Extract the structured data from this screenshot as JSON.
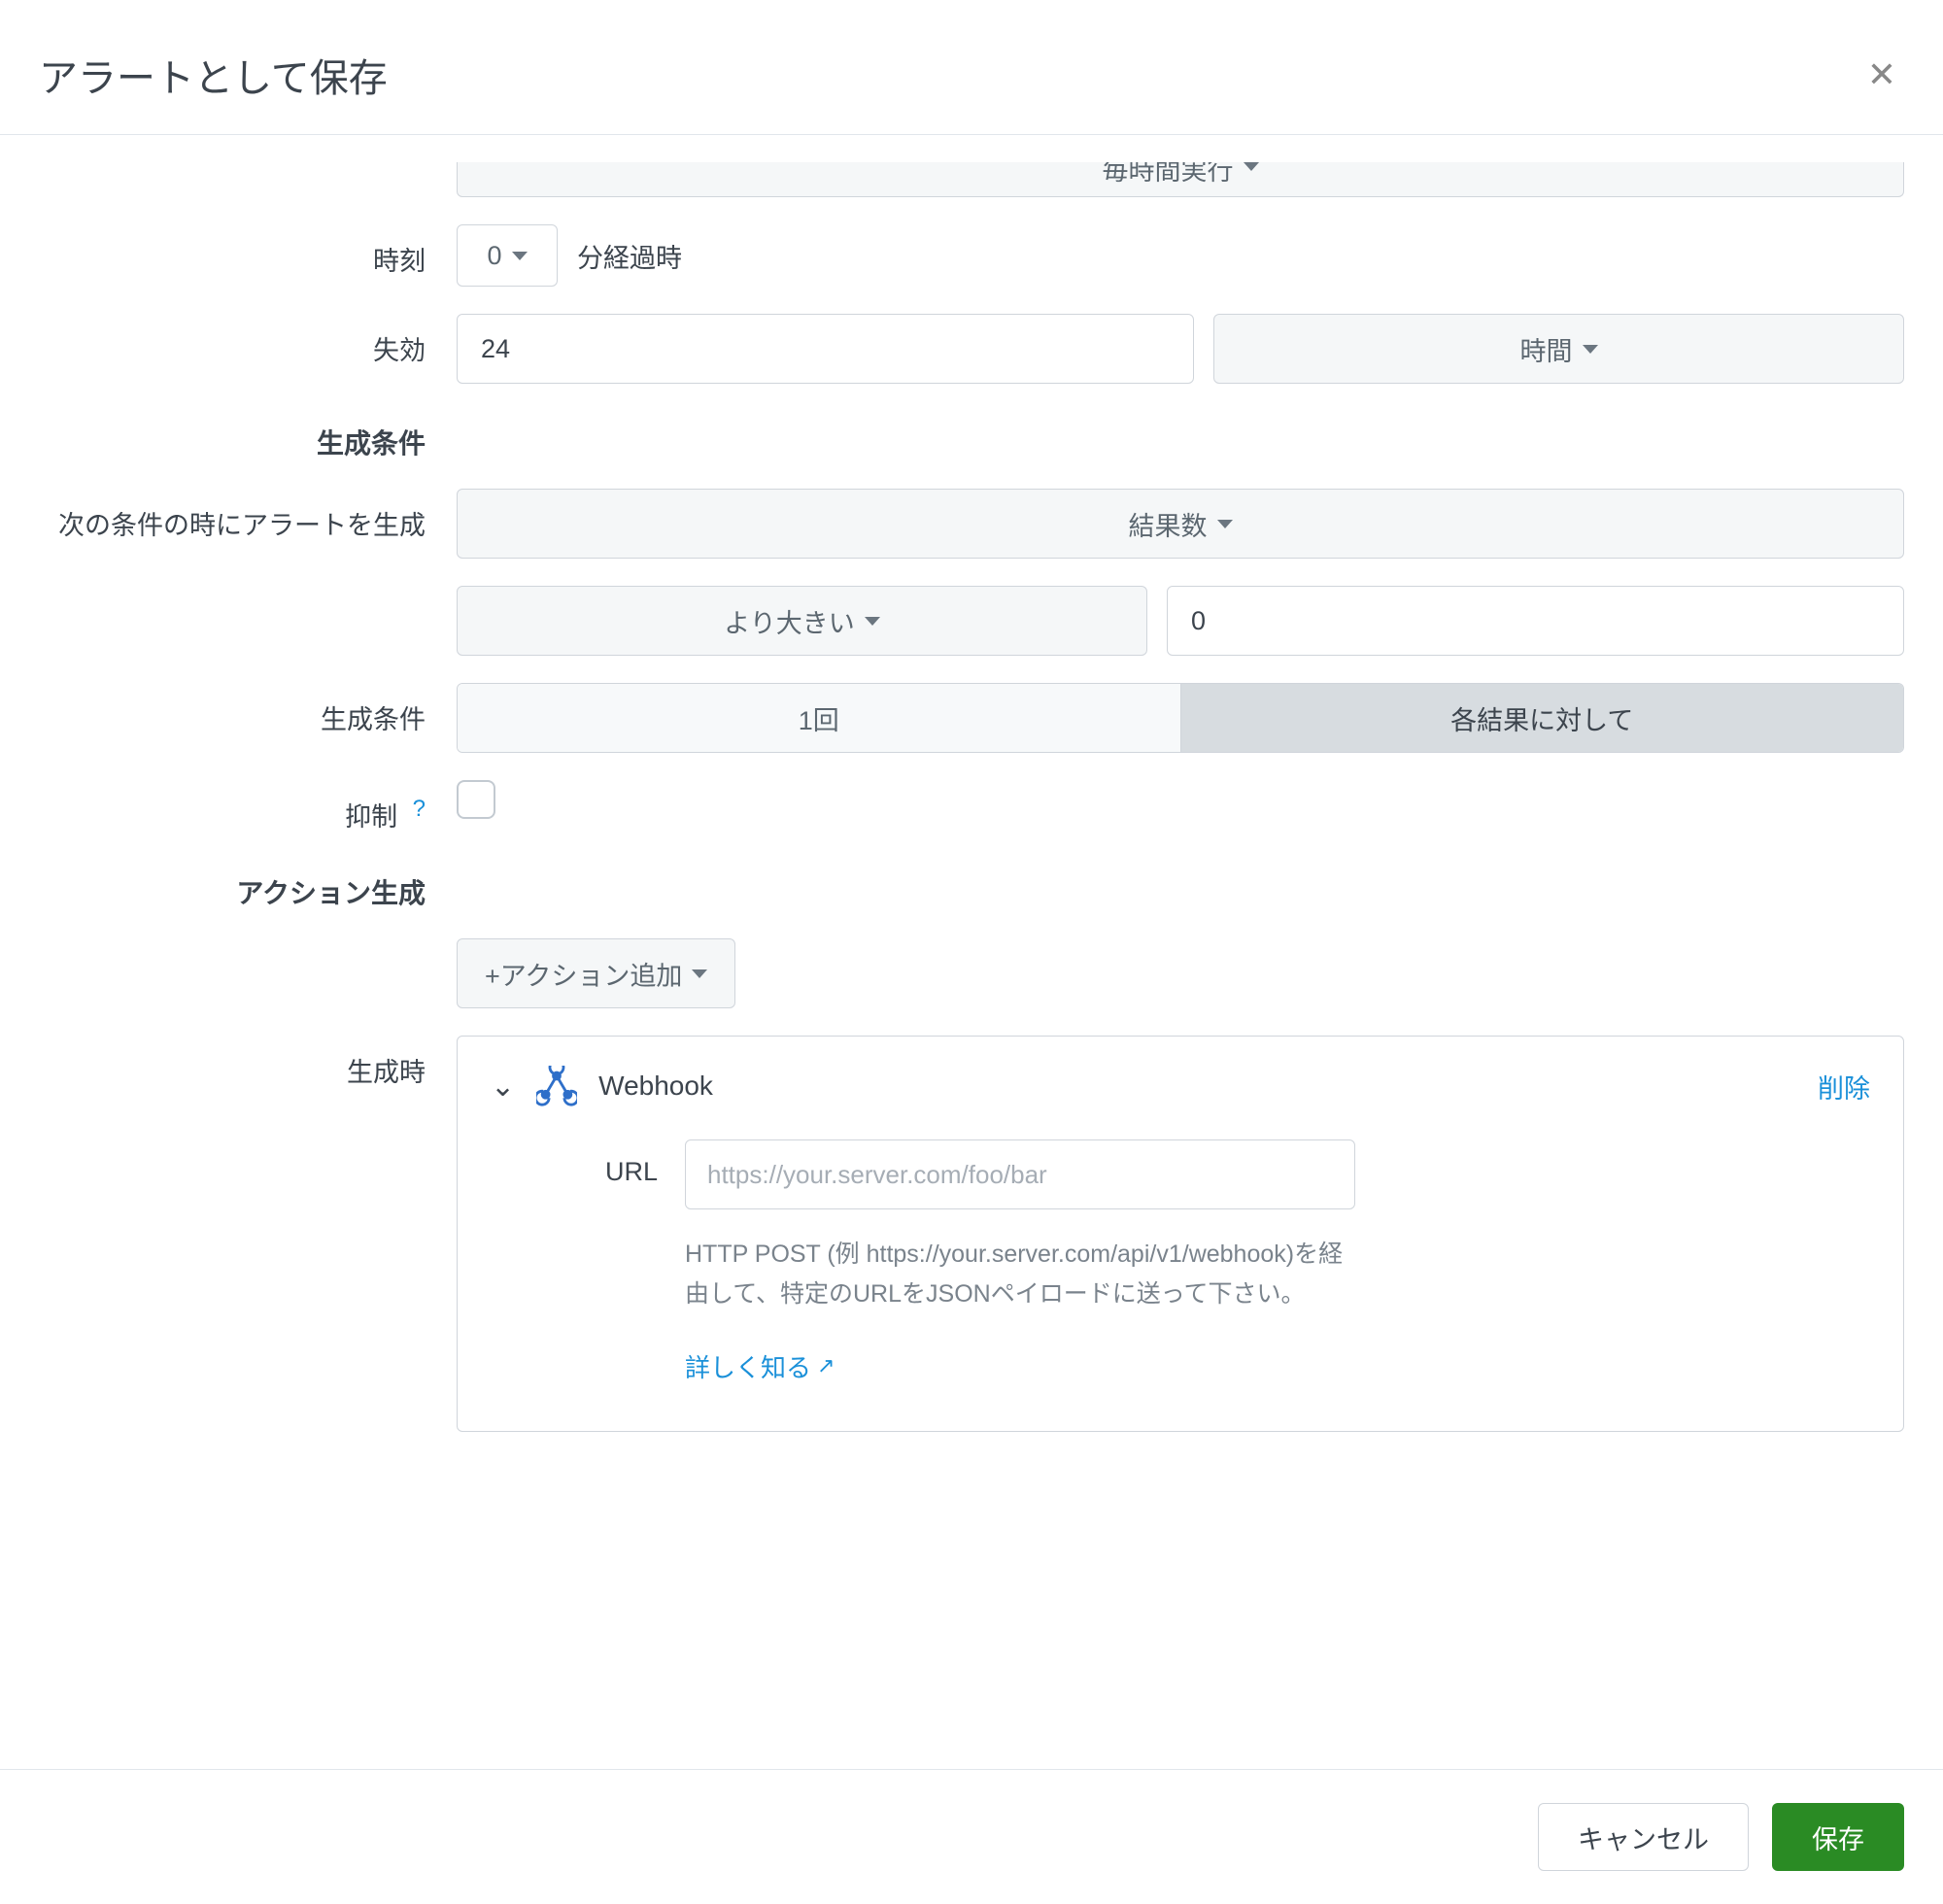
{
  "dialog": {
    "title": "アラートとして保存"
  },
  "schedule": {
    "run_label": "毎時間実行",
    "time_label": "時刻",
    "minutes_value": "0",
    "minutes_suffix": "分経過時"
  },
  "expires": {
    "label": "失効",
    "value": "24",
    "unit": "時間"
  },
  "trigger_section": {
    "header": "生成条件",
    "alert_when_label": "次の条件の時にアラートを生成",
    "metric": "結果数",
    "comparator": "より大きい",
    "threshold": "0",
    "mode_label": "生成条件",
    "mode_once": "1回",
    "mode_each": "各結果に対して",
    "throttle_label": "抑制",
    "throttle_help": "?"
  },
  "actions_section": {
    "header": "アクション生成",
    "add_button": "+アクション追加",
    "on_trigger_label": "生成時",
    "webhook": {
      "name": "Webhook",
      "delete": "削除",
      "url_label": "URL",
      "url_placeholder": "https://your.server.com/foo/bar",
      "help": "HTTP POST (例 https://your.server.com/api/v1/webhook)を経由して、特定のURLをJSONペイロードに送って下さい。",
      "learn_more": "詳しく知る"
    }
  },
  "footer": {
    "cancel": "キャンセル",
    "save": "保存"
  }
}
